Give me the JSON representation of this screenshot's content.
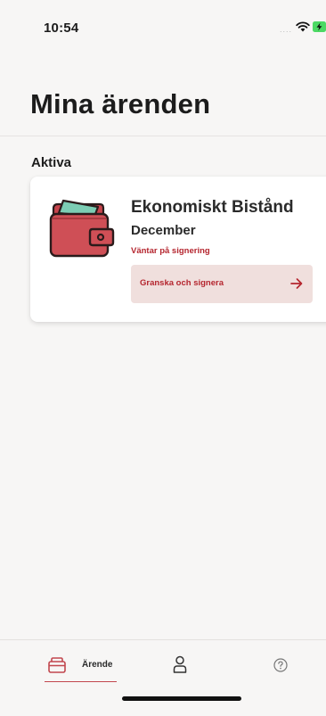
{
  "status_bar": {
    "time": "10:54",
    "signal": "....",
    "wifi_icon": "wifi-icon",
    "battery_icon": "battery-charging-icon"
  },
  "header": {
    "title": "Mina ärenden"
  },
  "sections": {
    "active_label": "Aktiva"
  },
  "case": {
    "icon": "wallet-icon",
    "title": "Ekonomiskt Bistånd",
    "subtitle": "December",
    "status": "Väntar på signering",
    "action_label": "Granska och signera",
    "action_icon": "arrow-right-icon"
  },
  "tab_bar": {
    "tabs": [
      {
        "label": "Ärende",
        "icon": "case-folder-icon",
        "selected": true
      },
      {
        "label": "",
        "icon": "profile-icon",
        "selected": false
      },
      {
        "label": "",
        "icon": "help-icon",
        "selected": false
      }
    ]
  },
  "colors": {
    "accent": "#b5262f",
    "button_bg": "#f0dfdd",
    "background": "#f7f6f5",
    "wallet": "#cf4f56"
  }
}
